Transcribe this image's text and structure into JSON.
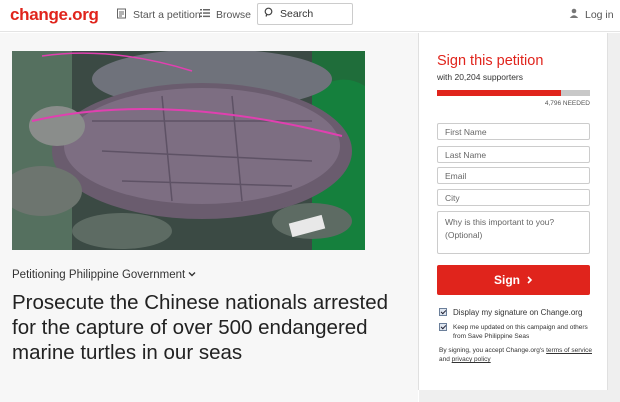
{
  "header": {
    "logo": "change.org",
    "start_petition": "Start a petition",
    "browse": "Browse",
    "search": "Search",
    "login": "Log in"
  },
  "petition": {
    "petitioning": "Petitioning Philippine Government",
    "title": "Prosecute the Chinese nationals arrested for the capture of over 500 endangered marine turtles in our seas"
  },
  "sign_panel": {
    "title": "Sign this petition",
    "supporters": "with 20,204 supporters",
    "needed": "4,796 NEEDED",
    "progress_fraction": 0.808,
    "fields": {
      "first_name": "First Name",
      "last_name": "Last Name",
      "email": "Email",
      "city": "City",
      "reason": "Why is this important to you? (Optional)"
    },
    "sign_button": "Sign",
    "display_signature": "Display my signature on Change.org",
    "keep_updated": "Keep me updated on this campaign and others from Save Philippine Seas",
    "terms_prefix": "By signing, you accept Change.org's ",
    "terms_link": "terms of service",
    "terms_and": " and ",
    "privacy_link": "privacy policy"
  },
  "colors": {
    "brand": "#e0241c"
  }
}
